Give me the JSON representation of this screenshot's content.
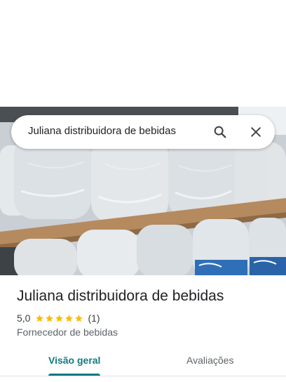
{
  "search": {
    "query": "Juliana distribuidora de bebidas",
    "search_icon": "search-icon",
    "clear_icon": "close-icon"
  },
  "photo": {
    "subject": "water-bottle-packs"
  },
  "place": {
    "name": "Juliana distribuidora de bebidas",
    "rating": "5,0",
    "stars": 5,
    "review_count": "(1)",
    "category": "Fornecedor de bebidas"
  },
  "tabs": [
    {
      "label": "Visão geral",
      "active": true
    },
    {
      "label": "Avaliações",
      "active": false
    }
  ],
  "colors": {
    "accent": "#137a7f",
    "star": "#fbbc04",
    "text_primary": "#202124",
    "text_secondary": "#5f6368"
  }
}
